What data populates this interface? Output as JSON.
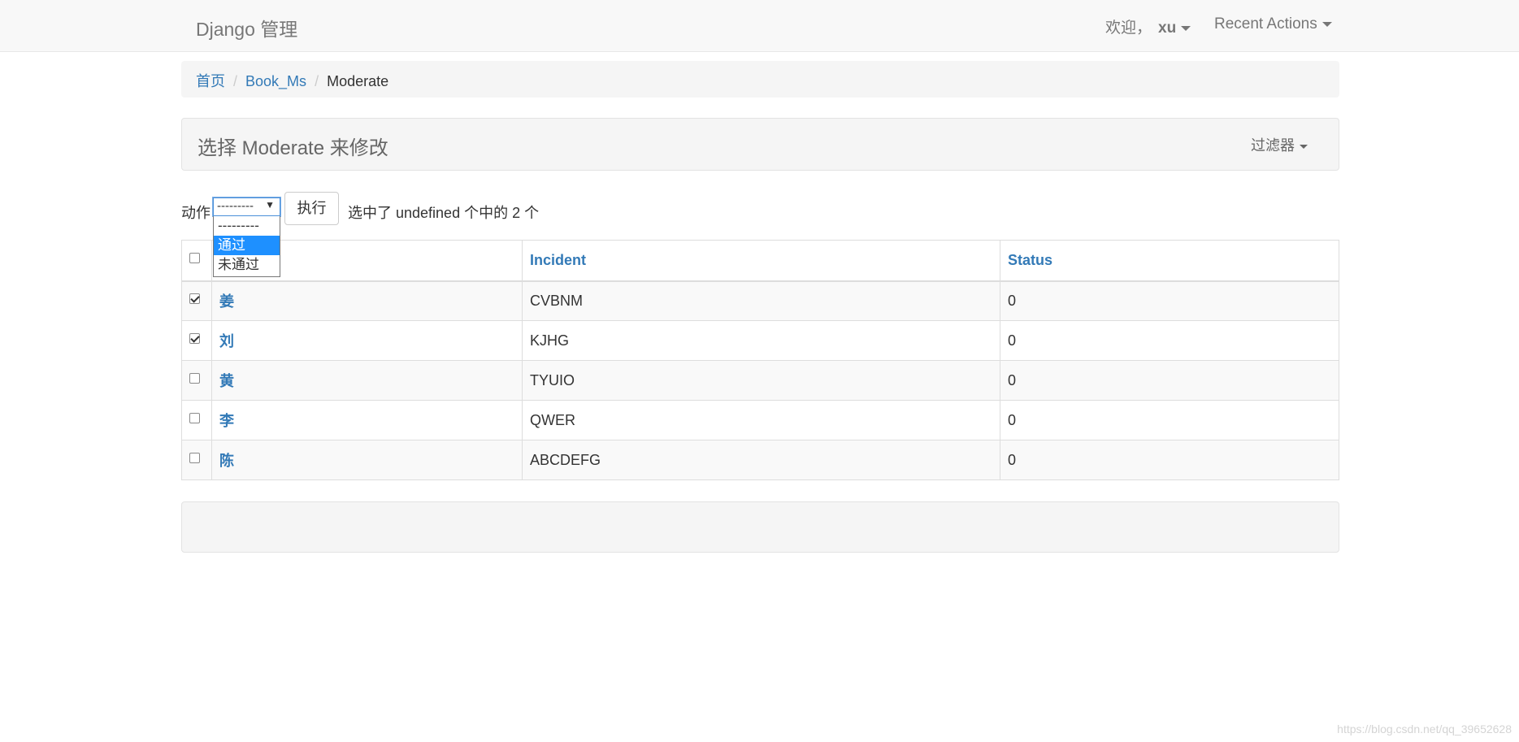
{
  "navbar": {
    "brand": "Django 管理",
    "welcome_label": "欢迎，",
    "username": "xu",
    "recent_actions": "Recent Actions"
  },
  "breadcrumb": {
    "home": "首页",
    "app": "Book_Ms",
    "current": "Moderate",
    "separator": "/"
  },
  "header": {
    "title": "选择 Moderate 来修改",
    "filter_label": "过滤器"
  },
  "actions": {
    "label": "动作",
    "selected_value": "---------",
    "options": [
      "---------",
      "通过",
      "未通过"
    ],
    "highlighted_option": "通过",
    "go_label": "执行",
    "counter_text": "选中了 undefined 个中的 2 个"
  },
  "table": {
    "columns": [
      "",
      "Incident",
      "Status"
    ],
    "rows": [
      {
        "name": "姜",
        "incident": "CVBNM",
        "status": "0",
        "checked": true
      },
      {
        "name": "刘",
        "incident": "KJHG",
        "status": "0",
        "checked": true
      },
      {
        "name": "黄",
        "incident": "TYUIO",
        "status": "0",
        "checked": false
      },
      {
        "name": "李",
        "incident": "QWER",
        "status": "0",
        "checked": false
      },
      {
        "name": "陈",
        "incident": "ABCDEFG",
        "status": "0",
        "checked": false
      }
    ]
  },
  "watermark": "https://blog.csdn.net/qq_39652628",
  "colors": {
    "link": "#337ab7",
    "navbar_bg": "#f8f8f8",
    "panel_bg": "#f5f5f5",
    "dropdown_highlight": "#1e90ff"
  }
}
